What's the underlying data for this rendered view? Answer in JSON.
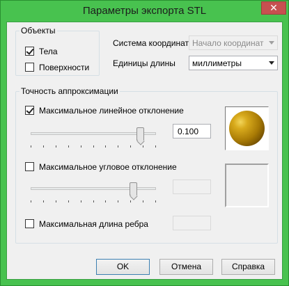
{
  "window": {
    "title": "Параметры экспорта STL",
    "close_glyph": "✕"
  },
  "objects": {
    "group_label": "Объекты",
    "bodies": {
      "label": "Тела",
      "checked": true
    },
    "surfaces": {
      "label": "Поверхности",
      "checked": false
    }
  },
  "coordinate_system": {
    "label": "Система координат",
    "value": "Начало координат",
    "enabled": false
  },
  "length_units": {
    "label": "Единицы длины",
    "value": "миллиметры"
  },
  "approximation": {
    "group_label": "Точность аппроксимации",
    "max_linear": {
      "label": "Максимальное линейное отклонение",
      "checked": true,
      "value": "0.100",
      "slider_position": 0.62
    },
    "max_angular": {
      "label": "Максимальное угловое отклонение",
      "checked": false,
      "value": "",
      "slider_position": 0.57
    },
    "max_edge": {
      "label": "Максимальная длина ребра",
      "checked": false,
      "value": ""
    }
  },
  "buttons": {
    "ok": "OK",
    "cancel": "Отмена",
    "help": "Справка"
  }
}
